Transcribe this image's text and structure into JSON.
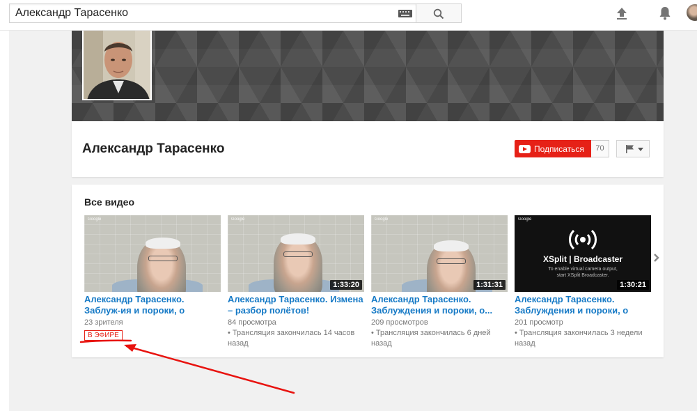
{
  "search": {
    "value": "Александр Тарасенко"
  },
  "channel": {
    "name": "Александр Тарасенко",
    "subscribe_label": "Подписаться",
    "subscriber_count": "70"
  },
  "videos_section": {
    "title": "Все видео",
    "videos": [
      {
        "title": "Александр Тарасенко. Заблуж-ия и пороки, о которых надо...",
        "views": "23 зрителя",
        "live_badge": "В ЭФИРЕ",
        "watermark": "Google"
      },
      {
        "title": "Александр Тарасенко. Измена – разбор полётов!",
        "views": "84 просмотра",
        "status": "• Трансляция закончилась 14 часов назад",
        "duration": "1:33:20",
        "watermark": "Google"
      },
      {
        "title": "Александр Тарасенко. Заблуждения и пороки, о...",
        "views": "209 просмотров",
        "status": "• Трансляция закончилась 6 дней назад",
        "duration": "1:31:31",
        "watermark": "Google"
      },
      {
        "title": "Александр Тарасенко. Заблуждения и пороки, о кот....",
        "views": "201 просмотр",
        "status": "• Трансляция закончилась 3 недели назад",
        "duration": "1:30:21",
        "watermark": "Google",
        "thumb_title": "XSplit | Broadcaster",
        "thumb_subtitle": "To enable virtual camera output,\nstart XSplit Broadcaster."
      }
    ]
  },
  "colors": {
    "link_blue": "#167ac6",
    "subscribe_red": "#e62117",
    "annotation_red": "#e8130f"
  },
  "icons": {
    "search": "magnifier-icon",
    "keyboard": "keyboard-icon",
    "upload": "upload-arrow-icon",
    "notifications": "bell-icon",
    "flag": "flag-icon",
    "next": "chevron-right-icon"
  }
}
